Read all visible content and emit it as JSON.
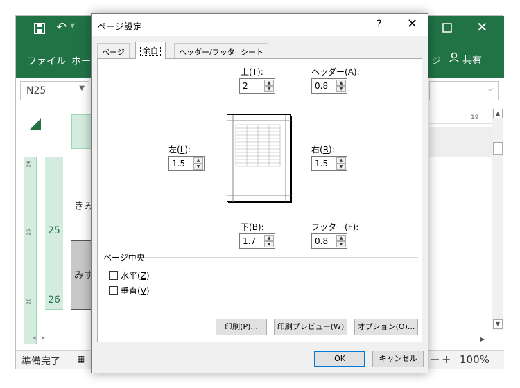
{
  "excel": {
    "tabs": [
      "ファイル",
      "ホー"
    ],
    "share_label": "共有",
    "name_box": "N25",
    "rows": [
      {
        "num": "25",
        "text": "きみ"
      },
      {
        "num": "26",
        "text": "みす"
      }
    ],
    "ruler_ticks": [
      "24",
      "25",
      "26"
    ],
    "ruler_right": "19",
    "status": "準備完了",
    "zoom": "100%"
  },
  "dialog": {
    "title": "ページ設定",
    "help": "?",
    "tabs": [
      {
        "label": "ページ",
        "active": false
      },
      {
        "label": "余白",
        "active": true
      },
      {
        "label": "ヘッダー/フッター",
        "active": false
      },
      {
        "label": "シート",
        "active": false
      }
    ],
    "margins": {
      "top": {
        "label": "上(",
        "key": "T",
        "suffix": "):",
        "value": "2"
      },
      "header": {
        "label": "ヘッダー(",
        "key": "A",
        "suffix": "):",
        "value": "0.8"
      },
      "left": {
        "label": "左(",
        "key": "L",
        "suffix": "):",
        "value": "1.5"
      },
      "right": {
        "label": "右(",
        "key": "R",
        "suffix": "):",
        "value": "1.5"
      },
      "bottom": {
        "label": "下(",
        "key": "B",
        "suffix": "):",
        "value": "1.7"
      },
      "footer": {
        "label": "フッター(",
        "key": "F",
        "suffix": "):",
        "value": "0.8"
      }
    },
    "center_section": "ページ中央",
    "horizontal": {
      "label": "水平(",
      "key": "Z",
      "suffix": ")"
    },
    "vertical": {
      "label": "垂直(",
      "key": "V",
      "suffix": ")"
    },
    "buttons": {
      "print": {
        "label": "印刷(",
        "key": "P",
        "suffix": ")..."
      },
      "preview": {
        "label": "印刷プレビュー(",
        "key": "W",
        "suffix": ")"
      },
      "options": {
        "label": "オプション(",
        "key": "O",
        "suffix": ")..."
      },
      "ok": "OK",
      "cancel": "キャンセル"
    }
  }
}
